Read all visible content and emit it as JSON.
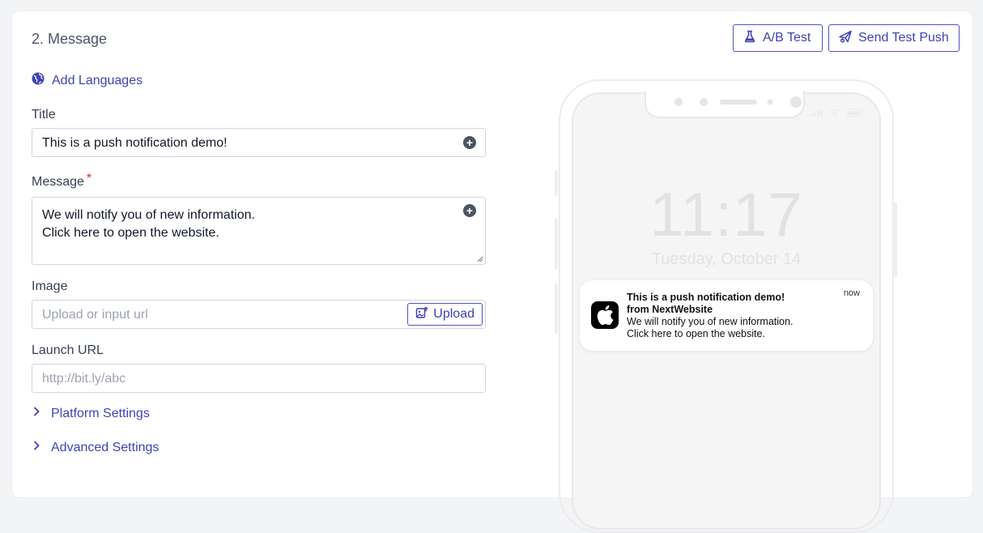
{
  "section": {
    "title": "2. Message"
  },
  "toolbar": {
    "ab_test_label": "A/B Test",
    "send_test_label": "Send Test Push"
  },
  "add_languages_label": "Add Languages",
  "form": {
    "title_label": "Title",
    "title_value": "This is a push notification demo!",
    "message_label": "Message",
    "message_required_mark": "*",
    "message_line1": "We will notify you of new information.",
    "message_line2": "Click here to open the website.",
    "image_label": "Image",
    "image_placeholder": "Upload or input url",
    "upload_label": "Upload",
    "launch_url_label": "Launch URL",
    "launch_url_placeholder": "http://bit.ly/abc"
  },
  "collapsibles": {
    "platform_settings": "Platform Settings",
    "advanced_settings": "Advanced Settings"
  },
  "preview": {
    "time": "11:17",
    "date": "Tuesday, October 14",
    "notification": {
      "title": "This is a push notification demo!",
      "from": "from NextWebsite",
      "body_line1": "We will notify you of new information.",
      "body_line2": "Click here to open the website.",
      "time": "now"
    }
  },
  "colors": {
    "accent": "#3f42b5",
    "required": "#dc2626"
  }
}
